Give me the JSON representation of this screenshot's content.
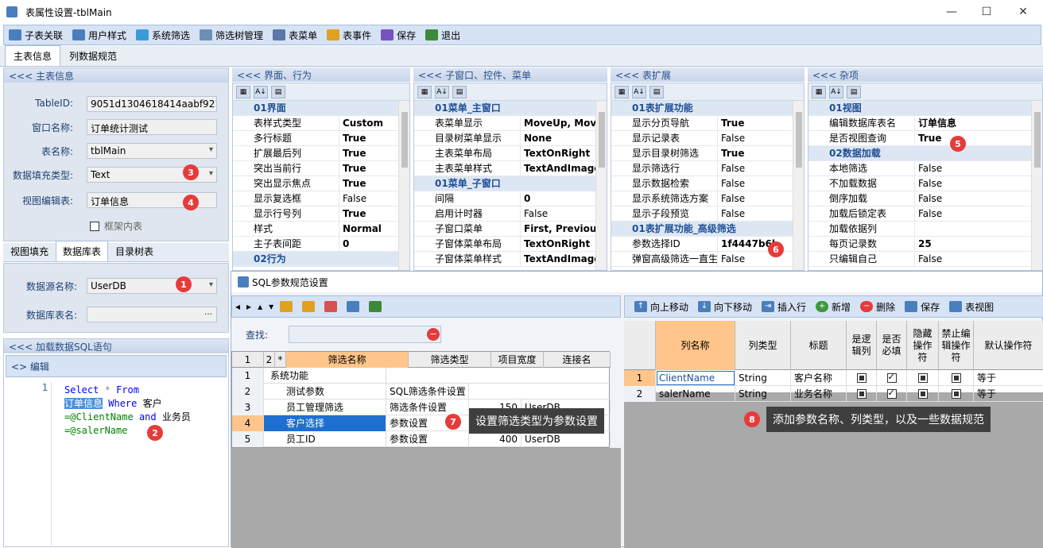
{
  "window": {
    "title": "表属性设置-tblMain",
    "min": "—",
    "max": "☐",
    "close": "✕"
  },
  "toolbar": [
    {
      "label": "子表关联",
      "icon": "child-table-icon",
      "color": "#4a7fbf"
    },
    {
      "label": "用户样式",
      "icon": "user-style-icon",
      "color": "#4a7fbf"
    },
    {
      "label": "系统筛选",
      "icon": "filter-icon",
      "color": "#3a9bd8"
    },
    {
      "label": "筛选树管理",
      "icon": "tree-icon",
      "color": "#6d8fb5"
    },
    {
      "label": "表菜单",
      "icon": "menu-icon",
      "color": "#5a78a8"
    },
    {
      "label": "表事件",
      "icon": "event-icon",
      "color": "#e0a020"
    },
    {
      "label": "保存",
      "icon": "save-icon",
      "color": "#7a4fc0"
    },
    {
      "label": "退出",
      "icon": "exit-icon",
      "color": "#3a8a3a"
    }
  ],
  "tabs": [
    "主表信息",
    "列数据规范"
  ],
  "main_info": {
    "header": "<<< 主表信息",
    "fields": [
      {
        "label": "TableID:",
        "value": "9051d1304618414aabf9217"
      },
      {
        "label": "窗口名称:",
        "value": "订单统计测试"
      },
      {
        "label": "表名称:",
        "value": "tblMain"
      },
      {
        "label": "数据填充类型:",
        "value": "Text"
      },
      {
        "label": "视图编辑表:",
        "value": "订单信息"
      }
    ],
    "checkbox": "框架内表"
  },
  "subtabs": [
    "视图填充",
    "数据库表",
    "目录树表"
  ],
  "db": {
    "ds_label": "数据源名称:",
    "ds_value": "UserDB",
    "tbl_label": "数据库表名:",
    "tbl_value": ""
  },
  "sql": {
    "header": "<<< 加载数据SQL语句",
    "edit": "<> 编辑",
    "line": "1",
    "l1a": "Select",
    "l1b": "*",
    "l1c": "From",
    "l2a": "订单信息",
    "l2b": "Where",
    "l2c": "客户",
    "l3a": "=@ClientName",
    "l3b": "and",
    "l3c": "业务员",
    "l4a": "=@salerName"
  },
  "panels": [
    {
      "header": "<<< 界面、行为",
      "rows": [
        {
          "c": 1,
          "k": "01界面"
        },
        {
          "k": "表样式类型",
          "v": "Custom",
          "b": 1
        },
        {
          "k": "多行标题",
          "v": "True",
          "b": 1
        },
        {
          "k": "扩展最后列",
          "v": "True",
          "b": 1
        },
        {
          "k": "突出当前行",
          "v": "True",
          "b": 1
        },
        {
          "k": "突出显示焦点",
          "v": "True",
          "b": 1
        },
        {
          "k": "显示复选框",
          "v": "False"
        },
        {
          "k": "显示行号列",
          "v": "True",
          "b": 1
        },
        {
          "k": "样式",
          "v": "Normal",
          "b": 1
        },
        {
          "k": "主子表间距",
          "v": "0",
          "b": 1
        },
        {
          "c": 1,
          "k": "02行为"
        }
      ]
    },
    {
      "header": "<<< 子窗口、控件、菜单",
      "rows": [
        {
          "c": 1,
          "k": "01菜单_主窗口"
        },
        {
          "k": "表菜单显示",
          "v": "MoveUp, Move",
          "b": 1
        },
        {
          "k": "目录树菜单显示",
          "v": "None",
          "b": 1
        },
        {
          "k": "主表菜单布局",
          "v": "TextOnRight",
          "b": 1
        },
        {
          "k": "主表菜单样式",
          "v": "TextAndImage",
          "b": 1
        },
        {
          "c": 1,
          "k": "01菜单_子窗口"
        },
        {
          "k": "间隔",
          "v": "0",
          "b": 1
        },
        {
          "k": "启用计时器",
          "v": "False"
        },
        {
          "k": "子窗口菜单",
          "v": "First, Previous,",
          "b": 1
        },
        {
          "k": "子窗体菜单布局",
          "v": "TextOnRight",
          "b": 1
        },
        {
          "k": "子窗体菜单样式",
          "v": "TextAndImage",
          "b": 1
        }
      ]
    },
    {
      "header": "<<< 表扩展",
      "rows": [
        {
          "c": 1,
          "k": "01表扩展功能"
        },
        {
          "k": "显示分页导航",
          "v": "True",
          "b": 1
        },
        {
          "k": "显示记录表",
          "v": "False"
        },
        {
          "k": "显示目录树筛选",
          "v": "True",
          "b": 1
        },
        {
          "k": "显示筛选行",
          "v": "False"
        },
        {
          "k": "显示数据检索",
          "v": "False"
        },
        {
          "k": "显示系统筛选方案",
          "v": "False"
        },
        {
          "k": "显示子段预览",
          "v": "False"
        },
        {
          "c": 1,
          "k": "01表扩展功能_高级筛选"
        },
        {
          "k": "参数选择ID",
          "v": "1f4447b6b",
          "b": 1
        },
        {
          "k": "弹窗高级筛选一直生",
          "v": "False"
        }
      ]
    },
    {
      "header": "<<< 杂项",
      "rows": [
        {
          "c": 1,
          "k": "01视图"
        },
        {
          "k": "编辑数据库表名",
          "v": "订单信息",
          "b": 1
        },
        {
          "k": "是否视图查询",
          "v": "True",
          "b": 1
        },
        {
          "c": 1,
          "k": "02数据加载"
        },
        {
          "k": "本地筛选",
          "v": "False"
        },
        {
          "k": "不加载数据",
          "v": "False"
        },
        {
          "k": "倒序加载",
          "v": "False"
        },
        {
          "k": "加载后锁定表",
          "v": "False"
        },
        {
          "k": "加载依据列",
          "v": ""
        },
        {
          "k": "每页记录数",
          "v": "25",
          "b": 1
        },
        {
          "k": "只编辑自己",
          "v": "False"
        }
      ]
    }
  ],
  "dialog": {
    "title": "SQL参数规范设置",
    "search_label": "查找:",
    "left_cols": [
      "1",
      "2",
      "*",
      "筛选名称",
      "筛选类型",
      "项目宽度",
      "连接名"
    ],
    "left_rows": [
      [
        "1",
        "系统功能",
        "",
        "",
        ""
      ],
      [
        "2",
        "测试参数",
        "SQL筛选条件设置",
        "",
        ""
      ],
      [
        "3",
        "员工管理筛选",
        "筛选条件设置",
        "150",
        "UserDB"
      ],
      [
        "4",
        "客户选择",
        "参数设置",
        "",
        ""
      ],
      [
        "5",
        "员工ID",
        "参数设置",
        "400",
        "UserDB"
      ]
    ],
    "right_tools": [
      "向上移动",
      "向下移动",
      "插入行",
      "新增",
      "删除",
      "保存",
      "表视图"
    ],
    "right_cols": [
      "列名称",
      "列类型",
      "标题",
      "是逻辑列",
      "是否必填",
      "隐藏操作符",
      "禁止编辑操作符",
      "默认操作符"
    ],
    "right_rows": [
      [
        "1",
        "ClientName",
        "String",
        "客户名称",
        "等于"
      ],
      [
        "2",
        "salerName",
        "String",
        "业务名称",
        "等于"
      ]
    ],
    "tip7": "设置筛选类型为参数设置",
    "tip8": "添加参数名称、列类型，以及一些数据规范"
  },
  "badges": [
    "1",
    "2",
    "3",
    "4",
    "5",
    "6",
    "7",
    "8"
  ]
}
